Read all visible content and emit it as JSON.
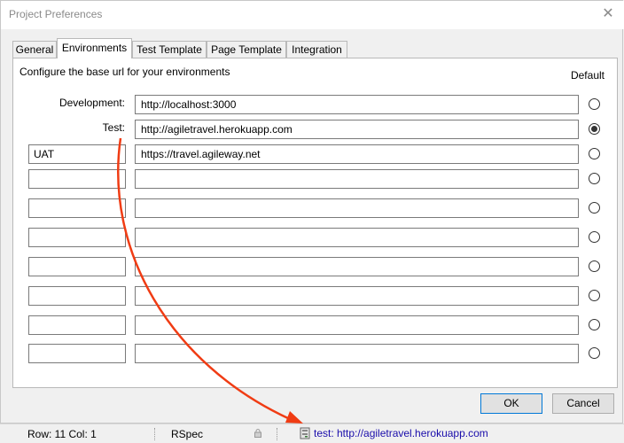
{
  "window": {
    "title": "Project Preferences",
    "close_glyph": "✕"
  },
  "tabs": [
    {
      "label": "General",
      "active": false
    },
    {
      "label": "Environments",
      "active": true
    },
    {
      "label": "Test Template",
      "active": false
    },
    {
      "label": "Page Template",
      "active": false
    },
    {
      "label": "Integration",
      "active": false
    }
  ],
  "environments": {
    "description": "Configure the base url for your environments",
    "default_header": "Default",
    "rows": [
      {
        "label": "Development:",
        "name": "",
        "url": "http://localhost:3000",
        "default": false
      },
      {
        "label": "Test:",
        "name": "",
        "url": "http://agiletravel.herokuapp.com",
        "default": true
      },
      {
        "label": "",
        "name": "UAT",
        "url": "https://travel.agileway.net",
        "default": false
      },
      {
        "label": "",
        "name": "",
        "url": "",
        "default": false
      },
      {
        "label": "",
        "name": "",
        "url": "",
        "default": false
      },
      {
        "label": "",
        "name": "",
        "url": "",
        "default": false
      },
      {
        "label": "",
        "name": "",
        "url": "",
        "default": false
      },
      {
        "label": "",
        "name": "",
        "url": "",
        "default": false
      },
      {
        "label": "",
        "name": "",
        "url": "",
        "default": false
      },
      {
        "label": "",
        "name": "",
        "url": "",
        "default": false
      }
    ]
  },
  "buttons": {
    "ok": "OK",
    "cancel": "Cancel"
  },
  "statusbar": {
    "position": "Row: 11  Col: 1",
    "mode": "RSpec",
    "environment": "test: http://agiletravel.herokuapp.com",
    "environment_icon": "server-icon"
  },
  "annotation": {
    "arrow_color": "#f03c14"
  }
}
